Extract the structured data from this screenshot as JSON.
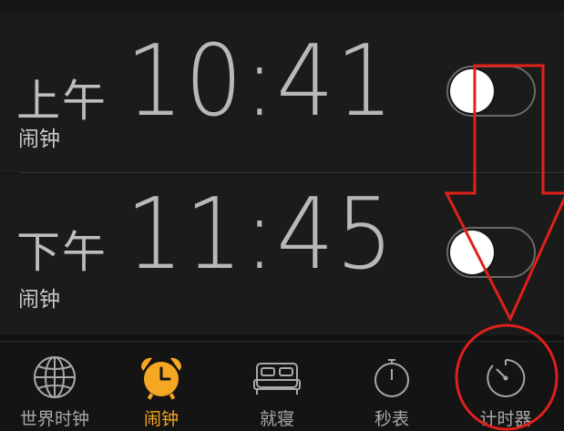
{
  "alarms": [
    {
      "period": "上午",
      "time": "10:41",
      "label": "闹钟",
      "enabled": false
    },
    {
      "period": "下午",
      "time": "11:45",
      "label": "闹钟",
      "enabled": false
    }
  ],
  "tabbar": {
    "tabs": [
      {
        "label": "世界时钟",
        "icon": "globe-icon",
        "active": false
      },
      {
        "label": "闹钟",
        "icon": "alarm-clock-icon",
        "active": true
      },
      {
        "label": "就寝",
        "icon": "bed-icon",
        "active": false
      },
      {
        "label": "秒表",
        "icon": "stopwatch-icon",
        "active": false
      },
      {
        "label": "计时器",
        "icon": "timer-icon",
        "active": false
      }
    ]
  },
  "annotations": {
    "arrow_color": "#e0201c",
    "circle_color": "#e0201c",
    "arrow_direction": "down",
    "circle_target": "计时器"
  },
  "colors": {
    "accent": "#f5a623",
    "background": "#1b1b1b",
    "tabbar_background": "#141414",
    "text_primary": "#b8b8b8",
    "tab_inactive": "#a8a8a8"
  }
}
